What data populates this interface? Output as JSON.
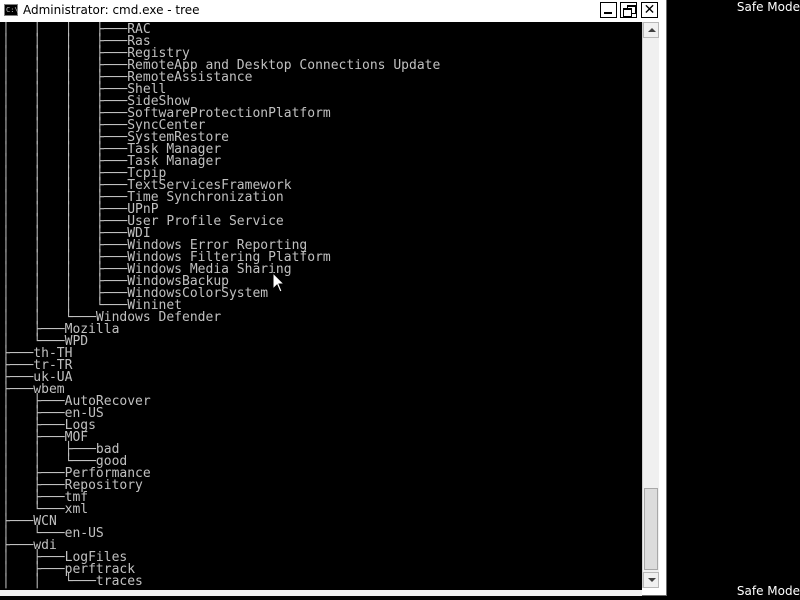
{
  "window": {
    "title": "Administrator: cmd.exe - tree",
    "icon_label": "C:\\",
    "buttons": {
      "minimize": "minimize-icon",
      "maximize": "restore-icon",
      "close": "✕"
    }
  },
  "desktop": {
    "safe_mode_top": "Safe Mode",
    "safe_mode_bottom": "Safe Mode"
  },
  "console": {
    "text_color": "#c0c0c0",
    "background": "#000000",
    "lines": [
      "│   │   │   ├───RAC",
      "│   │   │   ├───Ras",
      "│   │   │   ├───Registry",
      "│   │   │   ├───RemoteApp and Desktop Connections Update",
      "│   │   │   ├───RemoteAssistance",
      "│   │   │   ├───Shell",
      "│   │   │   ├───SideShow",
      "│   │   │   ├───SoftwareProtectionPlatform",
      "│   │   │   ├───SyncCenter",
      "│   │   │   ├───SystemRestore",
      "│   │   │   ├───Task Manager",
      "│   │   │   ├───Task Manager",
      "│   │   │   ├───Tcpip",
      "│   │   │   ├───TextServicesFramework",
      "│   │   │   ├───Time Synchronization",
      "│   │   │   ├───UPnP",
      "│   │   │   ├───User Profile Service",
      "│   │   │   ├───WDI",
      "│   │   │   ├───Windows Error Reporting",
      "│   │   │   ├───Windows Filtering Platform",
      "│   │   │   ├───Windows Media Sharing",
      "│   │   │   ├───WindowsBackup",
      "│   │   │   ├───WindowsColorSystem",
      "│   │   │   └───Wininet",
      "│   │   └───Windows Defender",
      "│   ├───Mozilla",
      "│   └───WPD",
      "├───th-TH",
      "├───tr-TR",
      "├───uk-UA",
      "├───wbem",
      "│   ├───AutoRecover",
      "│   ├───en-US",
      "│   ├───Logs",
      "│   ├───MOF",
      "│   │   ├───bad",
      "│   │   └───good",
      "│   ├───Performance",
      "│   ├───Repository",
      "│   ├───tmf",
      "│   └───xml",
      "├───WCN",
      "│   └───en-US",
      "├───wdi",
      "│   ├───LogFiles",
      "│   ├───perftrack",
      "│   │   └───traces"
    ]
  },
  "scrollbar": {
    "position_fraction": 0.93
  }
}
